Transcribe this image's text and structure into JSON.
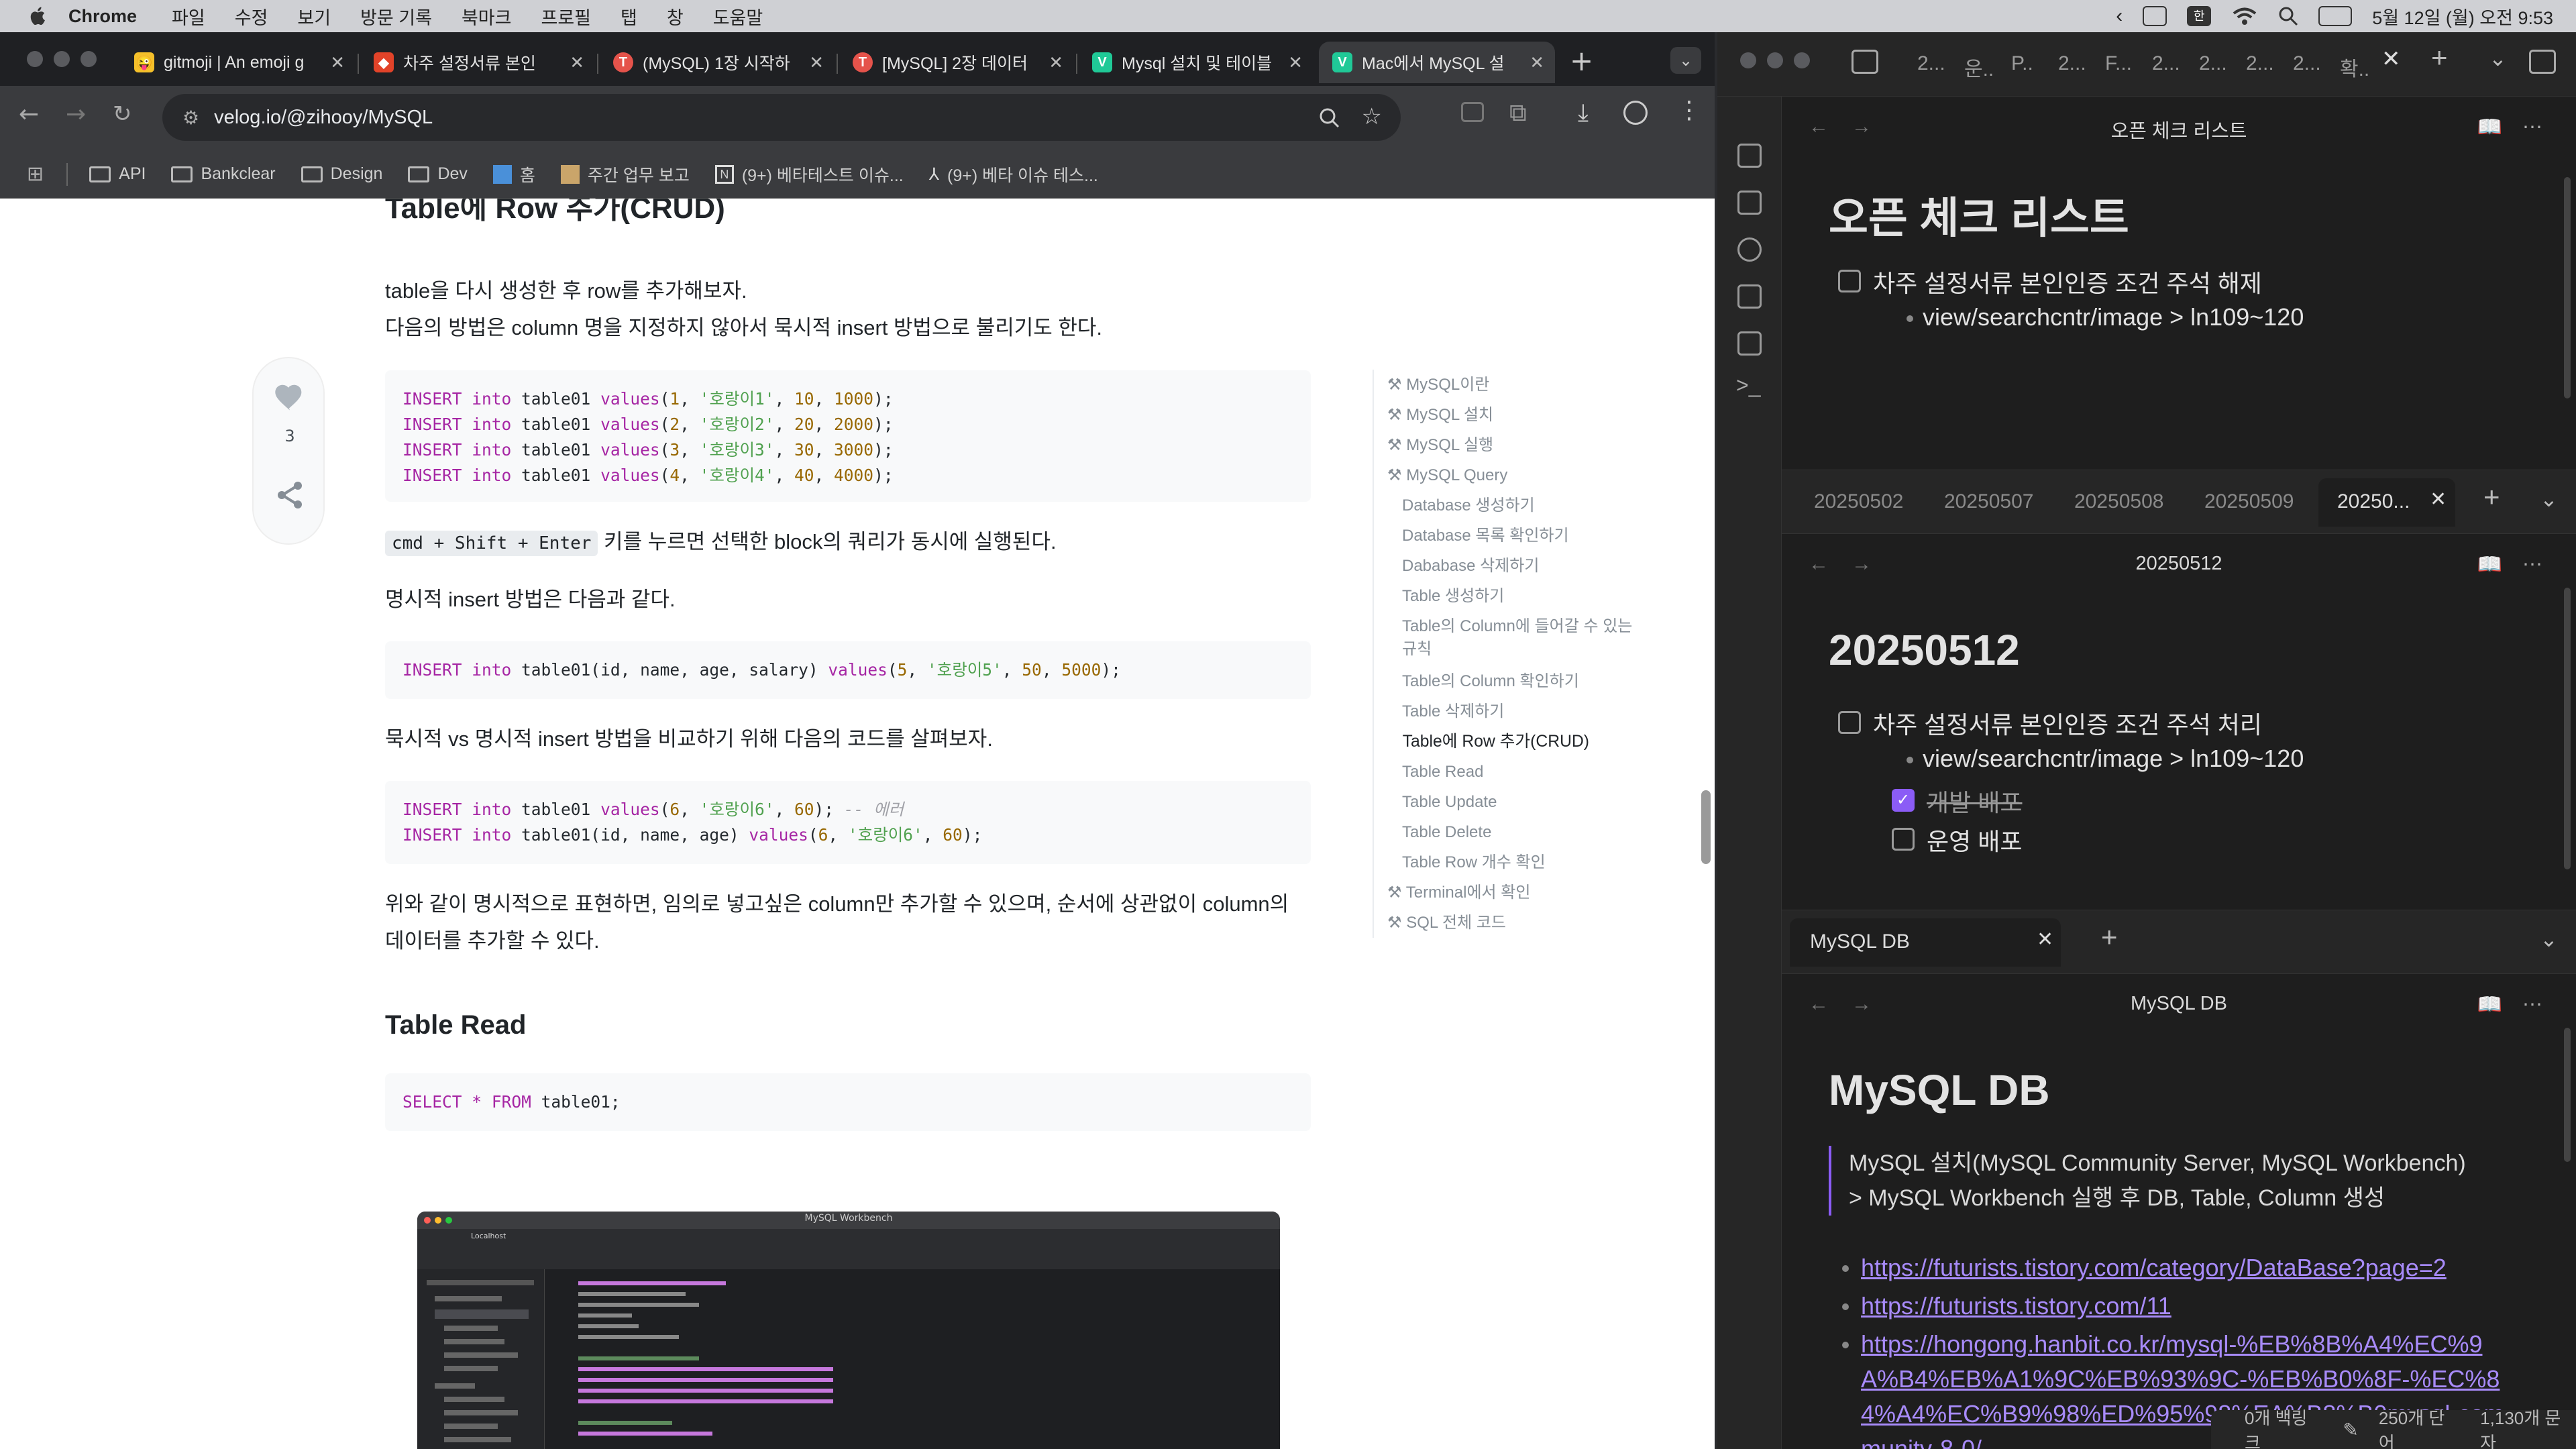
{
  "menubar": {
    "app": "Chrome",
    "items": [
      "파일",
      "수정",
      "보기",
      "방문 기록",
      "북마크",
      "프로필",
      "탭",
      "창",
      "도움말"
    ],
    "clock": "5월 12일 (월) 오전 9:53"
  },
  "chrome": {
    "tabs": [
      {
        "title": "gitmoji | An emoji g",
        "fav_color": "#f5c02a",
        "fav_text": "😜"
      },
      {
        "title": "차주 설정서류 본인",
        "fav_color": "#e24329",
        "fav_text": "🦊"
      },
      {
        "title": "(MySQL) 1장 시작하",
        "fav_color": "#e5534b",
        "fav_text": "T"
      },
      {
        "title": "[MySQL] 2장 데이터",
        "fav_color": "#e5534b",
        "fav_text": "T"
      },
      {
        "title": "Mysql 설치 및 테이블",
        "fav_color": "#20c997",
        "fav_text": "V"
      },
      {
        "title": "Mac에서 MySQL 설",
        "fav_color": "#20c997",
        "fav_text": "V"
      }
    ],
    "url": "velog.io/@zihooy/MySQL",
    "bookmarks": [
      "API",
      "Bankclear",
      "Design",
      "Dev",
      "홈",
      "주간 업무 보고",
      "(9+) 베타테스트 이슈...",
      "(9+) 베타 이슈 테스..."
    ]
  },
  "article": {
    "heading_partial": "Table에 Row 추가(CRUD)",
    "p1": "table을 다시 생성한 후 row를 추가해보자.",
    "p2": "다음의 방법은 column 명을 지정하지 않아서 묵시적 insert 방법으로 불리기도 한다.",
    "likes": "3",
    "code1": [
      {
        "id": 1,
        "name": "'호랑이1'",
        "age": 10,
        "salary": 1000
      },
      {
        "id": 2,
        "name": "'호랑이2'",
        "age": 20,
        "salary": 2000
      },
      {
        "id": 3,
        "name": "'호랑이3'",
        "age": 30,
        "salary": 3000
      },
      {
        "id": 4,
        "name": "'호랑이4'",
        "age": 40,
        "salary": 4000
      }
    ],
    "shortcut": "cmd + Shift + Enter",
    "shortcut_desc": "키를 누르면 선택한 block의 쿼리가 동시에 실행된다.",
    "p3": "명시적 insert 방법은 다음과 같다.",
    "code2": {
      "cols": "id, name, age, salary",
      "id": 5,
      "name": "'호랑이5'",
      "age": 50,
      "salary": 5000
    },
    "p4": "묵시적 vs 명시적 insert 방법을 비교하기 위해 다음의 코드를 살펴보자.",
    "code3_comment": "-- 에러",
    "code3a": {
      "id": 6,
      "name": "'호랑이6'",
      "age": 60
    },
    "code3b": {
      "cols": "id, name, age",
      "id": 6,
      "name": "'호랑이6'",
      "age": 60
    },
    "p5a": "위와 같이 명시적으로 표현하면, 임의로 넣고싶은 column만 추가할 수 있으며, 순서에 상관없이 column의",
    "p5b": "데이터를 추가할 수 있다.",
    "h_read": "Table Read",
    "code4": "table01",
    "screenshot_title": "MySQL Workbench",
    "screenshot_tab": "Localhost"
  },
  "toc": [
    {
      "t": "MySQL이란",
      "lvl": 0
    },
    {
      "t": "MySQL 설치",
      "lvl": 0
    },
    {
      "t": "MySQL 실행",
      "lvl": 0
    },
    {
      "t": "MySQL Query",
      "lvl": 0
    },
    {
      "t": "Database 생성하기",
      "lvl": 1
    },
    {
      "t": "Database 목록 확인하기",
      "lvl": 1
    },
    {
      "t": "Dababase 삭제하기",
      "lvl": 1
    },
    {
      "t": "Table 생성하기",
      "lvl": 1
    },
    {
      "t": "Table의 Column에 들어갈 수 있는",
      "lvl": 1
    },
    {
      "t": "규칙",
      "lvl": 1
    },
    {
      "t": "Table의 Column 확인하기",
      "lvl": 1
    },
    {
      "t": "Table 삭제하기",
      "lvl": 1
    },
    {
      "t": "Table에 Row 추가(CRUD)",
      "lvl": 1,
      "cur": true
    },
    {
      "t": "Table Read",
      "lvl": 1
    },
    {
      "t": "Table Update",
      "lvl": 1
    },
    {
      "t": "Table Delete",
      "lvl": 1
    },
    {
      "t": "Table Row 개수 확인",
      "lvl": 1
    },
    {
      "t": "Terminal에서 확인",
      "lvl": 0
    },
    {
      "t": "SQL 전체 코드",
      "lvl": 0
    }
  ],
  "obsidian": {
    "top_tabs": [
      "2...",
      "운..",
      "P..",
      "2...",
      "F...",
      "2...",
      "2...",
      "2...",
      "2...",
      "확.."
    ],
    "pane1": {
      "nav_title": "오픈 체크 리스트",
      "h1": "오픈 체크 리스트",
      "item": "차주 설정서류 본인인증 조건 주석 해제",
      "sub": "view/searchcntr/image > ln109~120"
    },
    "pane2_tabs": [
      "20250502",
      "20250507",
      "20250508",
      "20250509",
      "20250..."
    ],
    "pane2": {
      "nav_title": "20250512",
      "h1": "20250512",
      "item": "차주 설정서류 본인인증 조건 주석 처리",
      "sub": "view/searchcntr/image > ln109~120",
      "dev": "개발 배포",
      "prod": "운영 배포"
    },
    "pane3_tab": "MySQL DB",
    "pane3": {
      "nav_title": "MySQL DB",
      "h1": "MySQL DB",
      "quote1": "MySQL 설치(MySQL Community Server, MySQL Workbench)",
      "quote2": "> MySQL Workbench 실행 후 DB, Table, Column 생성",
      "links": [
        "https://futurists.tistory.com/category/DataBase?page=2",
        "https://futurists.tistory.com/11",
        "https://hongong.hanbit.co.kr/mysql-%EB%8B%A4%EC%9",
        "A%B4%EB%A1%9C%EB%93%9C-%EB%B0%8F-%EC%8",
        "4%A4%EC%B9%98%ED%95%98%EA%B8%B0mysql-com",
        "munity-8-0/"
      ]
    },
    "status": {
      "backlinks": "0개 백링크",
      "words": "250개 단어",
      "chars": "1,130개 문자"
    }
  }
}
